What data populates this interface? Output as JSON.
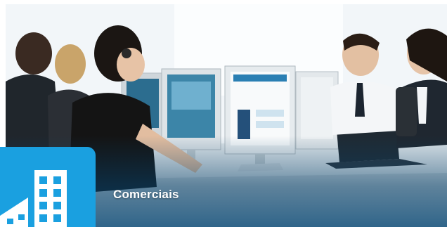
{
  "card": {
    "caption": "Comerciais",
    "accent_color": "#1aa0e0",
    "icon": "building-icon"
  },
  "photo": {
    "subject": ""
  }
}
